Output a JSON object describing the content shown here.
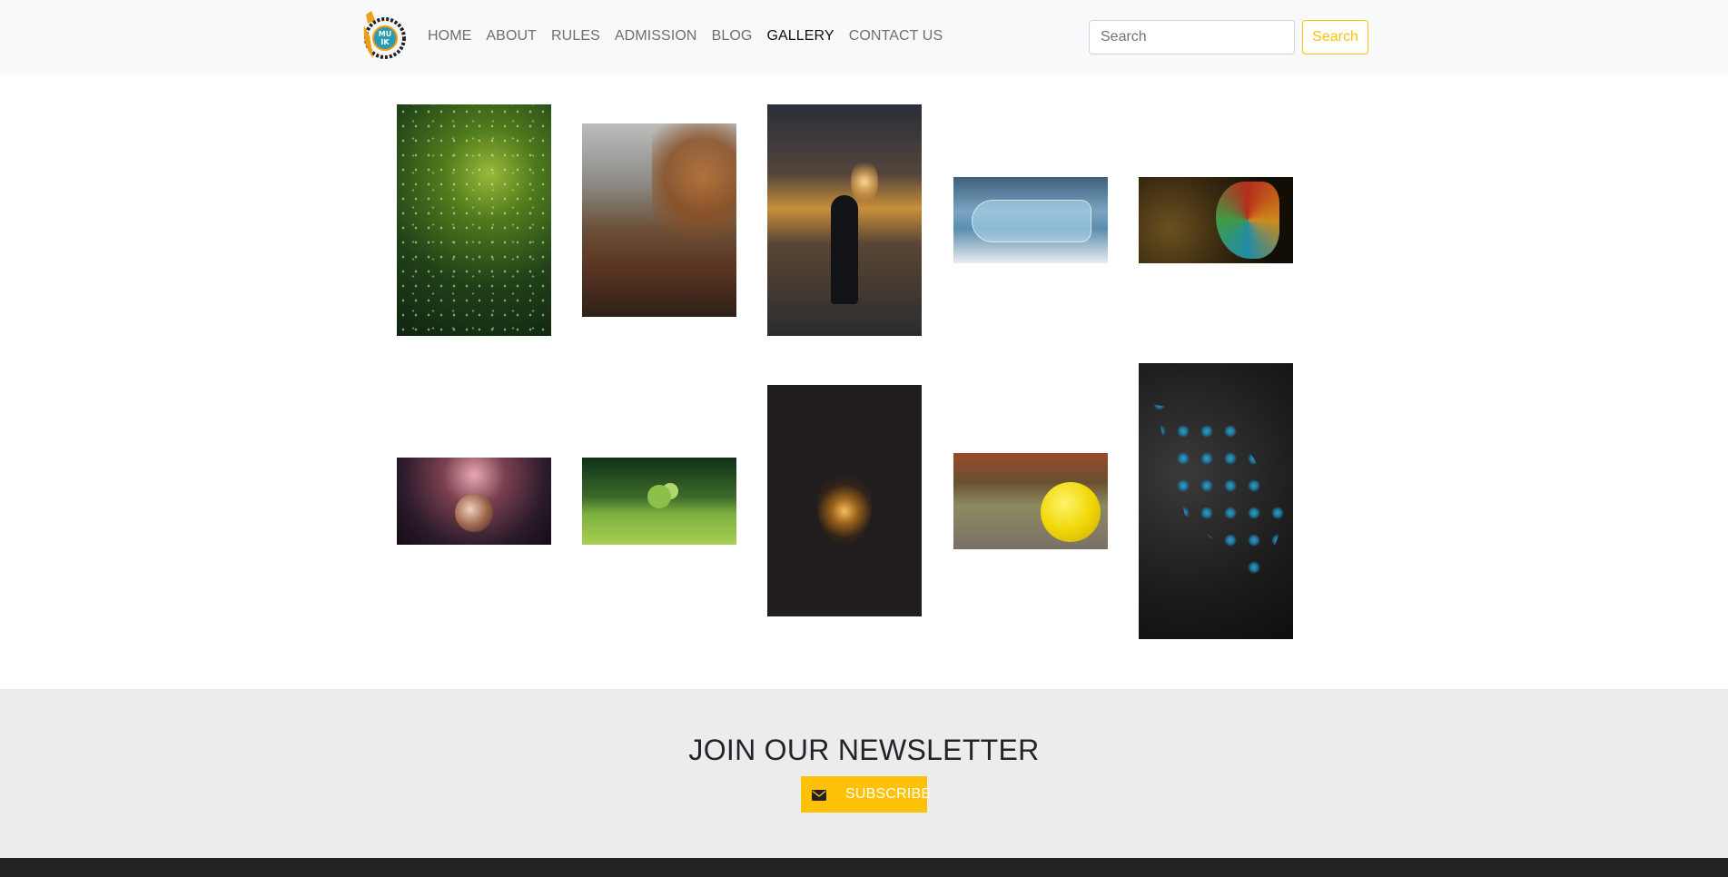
{
  "navbar": {
    "logo_text": "MU IK",
    "links": [
      {
        "label": "HOME"
      },
      {
        "label": "ABOUT"
      },
      {
        "label": "RULES"
      },
      {
        "label": "ADMISSION"
      },
      {
        "label": "BLOG"
      },
      {
        "label": "GALLERY"
      },
      {
        "label": "CONTACT US"
      }
    ],
    "active": "GALLERY",
    "search_placeholder": "Search",
    "search_button": "Search"
  },
  "gallery": {
    "photos": [
      {
        "name": "leaves-bokeh-photo"
      },
      {
        "name": "autumn-forest-path-photo"
      },
      {
        "name": "person-walking-street-photo"
      },
      {
        "name": "island-in-bottle-photo"
      },
      {
        "name": "colorful-feather-photo"
      },
      {
        "name": "glass-sphere-photo"
      },
      {
        "name": "sprout-photo"
      },
      {
        "name": "light-bulb-photo"
      },
      {
        "name": "winking-smiley-ball-photo"
      },
      {
        "name": "blue-water-drops-leaf-photo"
      }
    ]
  },
  "newsletter": {
    "title": "JOIN OUR NEWSLETTER",
    "button_label": "SUBSCRIBE",
    "icon": "envelope-icon"
  },
  "colors": {
    "accent": "#ffc107",
    "navbar_bg": "#f8f9fa",
    "newsletter_bg": "#ececec",
    "footer_bg": "#222222"
  }
}
